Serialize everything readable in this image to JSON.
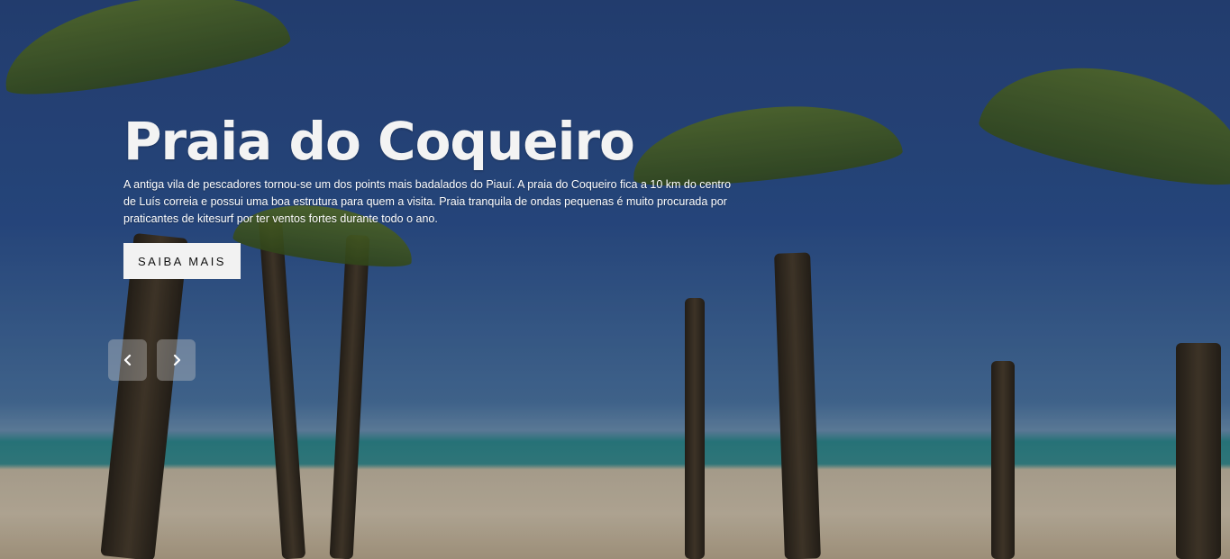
{
  "hero": {
    "title": "Praia do Coqueiro",
    "description": "A antiga vila de pescadores tornou-se um dos points mais badalados do Piauí. A praia do Coqueiro fica a 10 km do centro de Luís correia e possui uma boa estrutura para quem a visita. Praia tranquila de ondas pequenas é muito procurada por praticantes de kitesurf por ter ventos fortes durante todo o ano.",
    "cta_label": "SAIBA MAIS"
  },
  "carousel": {
    "prev_icon": "chevron-left-icon",
    "next_icon": "chevron-right-icon"
  },
  "colors": {
    "button_bg": "#f2f2f2",
    "button_text": "#111111",
    "title_text": "#f3f3f3",
    "nav_bg": "rgba(200,200,200,0.38)"
  }
}
